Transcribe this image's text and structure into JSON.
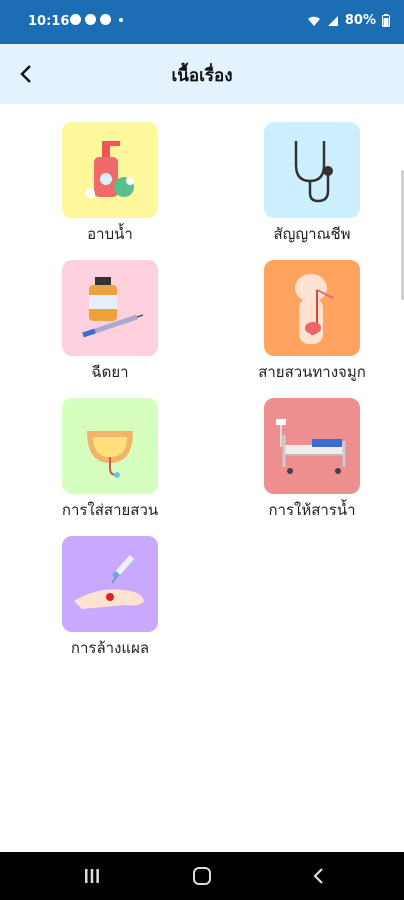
{
  "status": {
    "time": "10:16",
    "battery": "80%"
  },
  "appbar": {
    "title": "เนื้อเรื่อง"
  },
  "items": [
    {
      "label": "อาบน้ำ",
      "color": "#fff79c"
    },
    {
      "label": "สัญญาณชีพ",
      "color": "#cdefff"
    },
    {
      "label": "ฉีดยา",
      "color": "#ffd0de"
    },
    {
      "label": "สายสวนทางจมูก",
      "color": "#ffa35f"
    },
    {
      "label": "การใส่สายสวน",
      "color": "#d6ffbf"
    },
    {
      "label": "การให้สารน้ำ",
      "color": "#ef8e8e"
    },
    {
      "label": "การล้างแผล",
      "color": "#c9a8ff"
    }
  ]
}
